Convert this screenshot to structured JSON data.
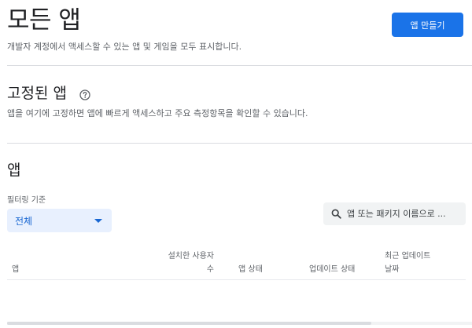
{
  "header": {
    "title": "모든 앱",
    "subtitle": "개발자 계정에서 액세스할 수 있는 앱 및 게임을 모두 표시합니다.",
    "create_button": "앱 만들기"
  },
  "pinned": {
    "title": "고정된 앱",
    "help_icon": "help-circle-icon",
    "description": "앱을 여기에 고정하면 앱에 빠르게 액세스하고 주요 측정항목을 확인할 수 있습니다."
  },
  "apps": {
    "title": "앱",
    "filter_label": "필터링 기준",
    "filter_value": "전체",
    "search_placeholder": "앱 또는 패키지 이름으로 ...",
    "search_icon": "search-icon",
    "columns": {
      "app": "앱",
      "installs_line1": "설치한 사용자",
      "installs_line2": "수",
      "app_status": "앱 상태",
      "update_status": "업데이트 상태",
      "last_update_line1": "최근 업데이트",
      "last_update_line2": "날짜"
    }
  },
  "colors": {
    "accent": "#1a73e8",
    "filter_bg": "#e8f0fe",
    "divider": "#dadce0"
  }
}
